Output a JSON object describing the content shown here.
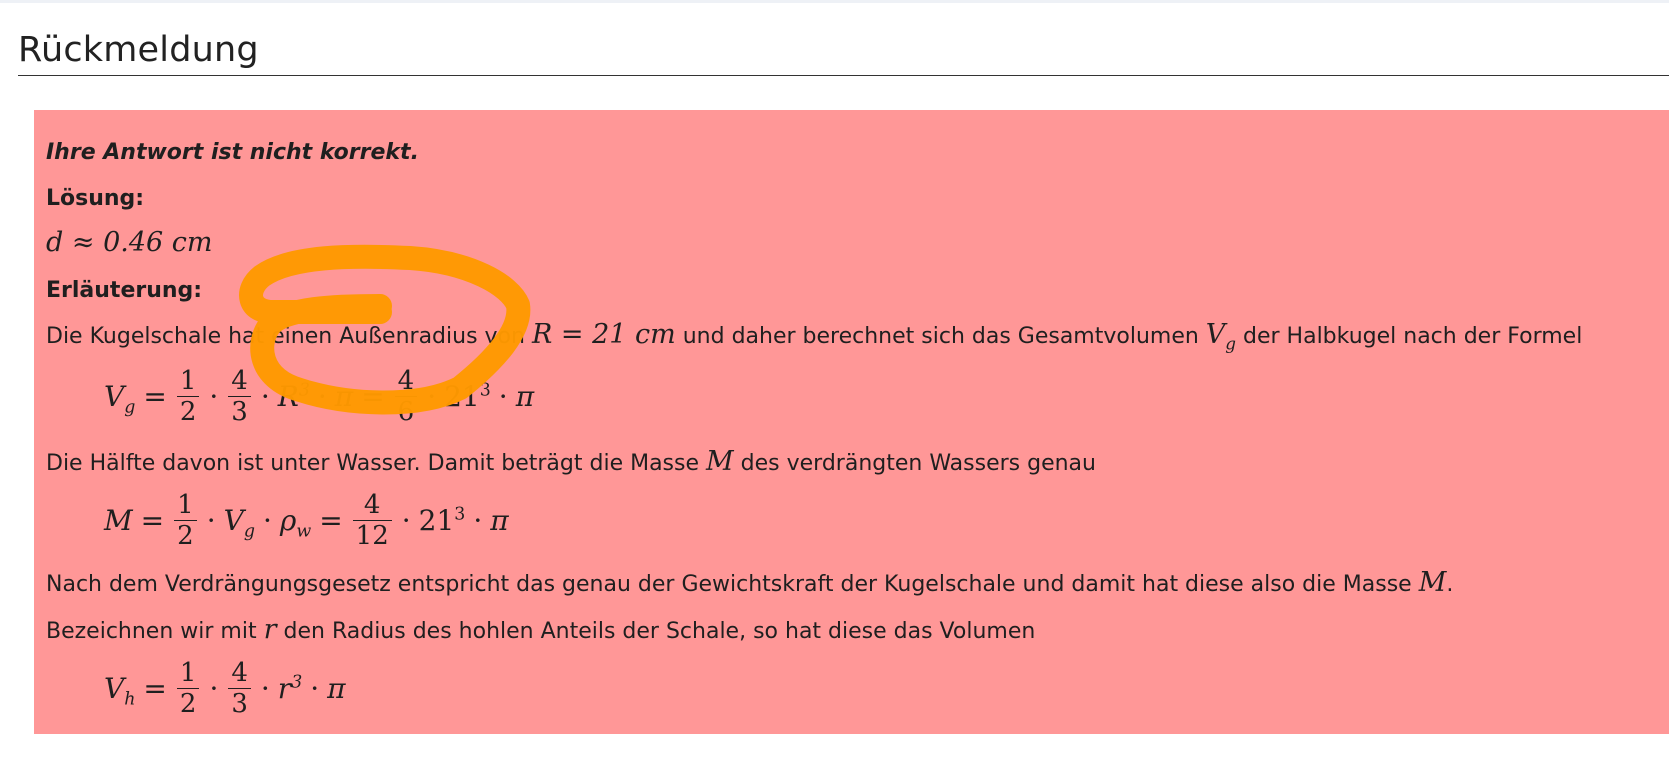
{
  "section": {
    "title": "Rückmeldung"
  },
  "feedback": {
    "status": "Ihre Antwort ist nicht korrekt.",
    "solution_label": "Lösung:",
    "solution_value": "d ≈ 0.46 cm",
    "explanation_label": "Erläuterung:",
    "p1_text_a": "Die Kugelschale hat einen Außenradius von ",
    "p1_math_a": "R = 21 cm",
    "p1_text_b": " und daher berechnet sich das Gesamtvolumen ",
    "p1_math_b_base": "V",
    "p1_math_b_sub": "g",
    "p1_text_c": " der Halbkugel nach der Formel",
    "p2_text_a": "Die Hälfte davon ist unter Wasser. Damit beträgt die Masse ",
    "p2_math": "M",
    "p2_text_b": " des verdrängten Wassers genau",
    "p3_text_a": "Nach dem Verdrängungsgesetz entspricht das genau der Gewichtskraft der Kugelschale und damit hat diese also die Masse ",
    "p3_math": "M",
    "p3_text_b": ".",
    "p4_text_a": "Bezeichnen wir mit ",
    "p4_math": "r",
    "p4_text_b": " den Radius des hohlen Anteils der Schale, so hat diese das Volumen",
    "eq1": {
      "lhs_base": "V",
      "lhs_sub": "g",
      "f1_num": "1",
      "f1_den": "2",
      "f2_num": "4",
      "f2_den": "3",
      "mid": "R",
      "mid_exp": "3",
      "pi": "π",
      "f3_num": "4",
      "f3_den": "6",
      "tail": "21",
      "tail_exp": "3"
    },
    "eq2": {
      "lhs": "M",
      "f1_num": "1",
      "f1_den": "2",
      "v_base": "V",
      "v_sub": "g",
      "rho_base": "ρ",
      "rho_sub": "w",
      "f2_num": "4",
      "f2_den": "12",
      "tail": "21",
      "tail_exp": "3",
      "pi": "π"
    },
    "eq3": {
      "lhs_base": "V",
      "lhs_sub": "h",
      "f1_num": "1",
      "f1_den": "2",
      "f2_num": "4",
      "f2_den": "3",
      "mid": "r",
      "mid_exp": "3",
      "pi": "π"
    }
  },
  "colors": {
    "feedback_background": "#ff9797",
    "annotation_stroke": "#ff9900"
  }
}
